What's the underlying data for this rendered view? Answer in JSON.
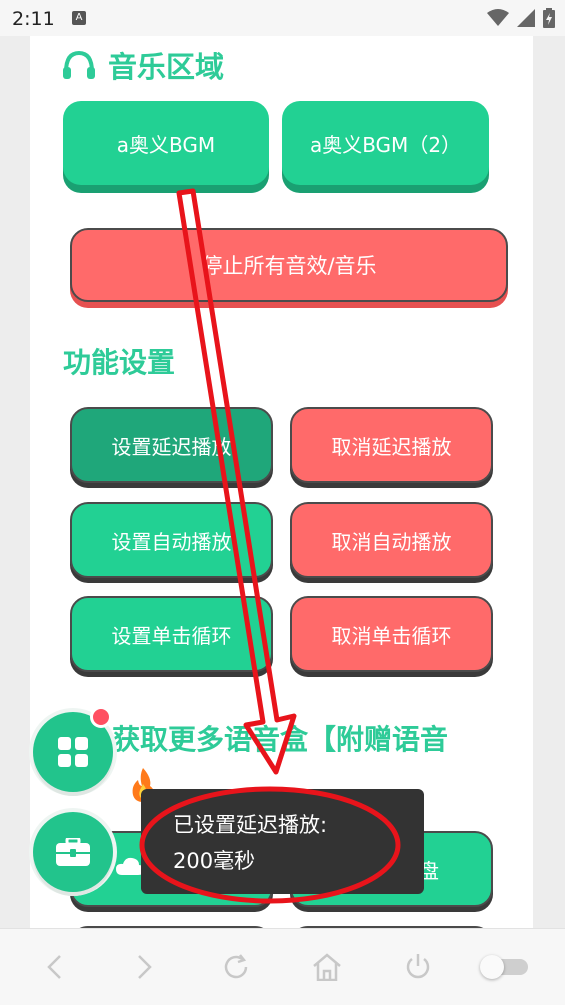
{
  "status_bar": {
    "time": "2:11",
    "notification_icon": "a-icon",
    "icons": [
      "wifi-icon",
      "signal-icon",
      "battery-icon"
    ]
  },
  "music": {
    "heading": "音乐区域",
    "icon": "headphones-icon",
    "bgm1": "a奥义BGM",
    "bgm2": "a奥义BGM（2）",
    "stop_all": "停止所有音效/音乐"
  },
  "settings": {
    "heading": "功能设置",
    "set_delay": "设置延迟播放",
    "cancel_delay": "取消延迟播放",
    "set_auto": "设置自动播放",
    "cancel_auto": "取消自动播放",
    "set_loop": "设置单击循环",
    "cancel_loop": "取消单击循环"
  },
  "more": {
    "heading_part": "获取更多语音盒【附赠语音",
    "right_btn_fragment": "盘"
  },
  "toast": {
    "line1": "已设置延迟播放:",
    "line2": "200毫秒"
  },
  "fabs": [
    "grid-icon",
    "toolbox-icon"
  ],
  "nav": [
    "back-icon",
    "forward-icon",
    "refresh-icon",
    "home-icon",
    "power-icon",
    "toggle-switch"
  ],
  "colors": {
    "accent": "#22d193",
    "danger": "#ff6a6a",
    "annotation": "#e8141b"
  }
}
